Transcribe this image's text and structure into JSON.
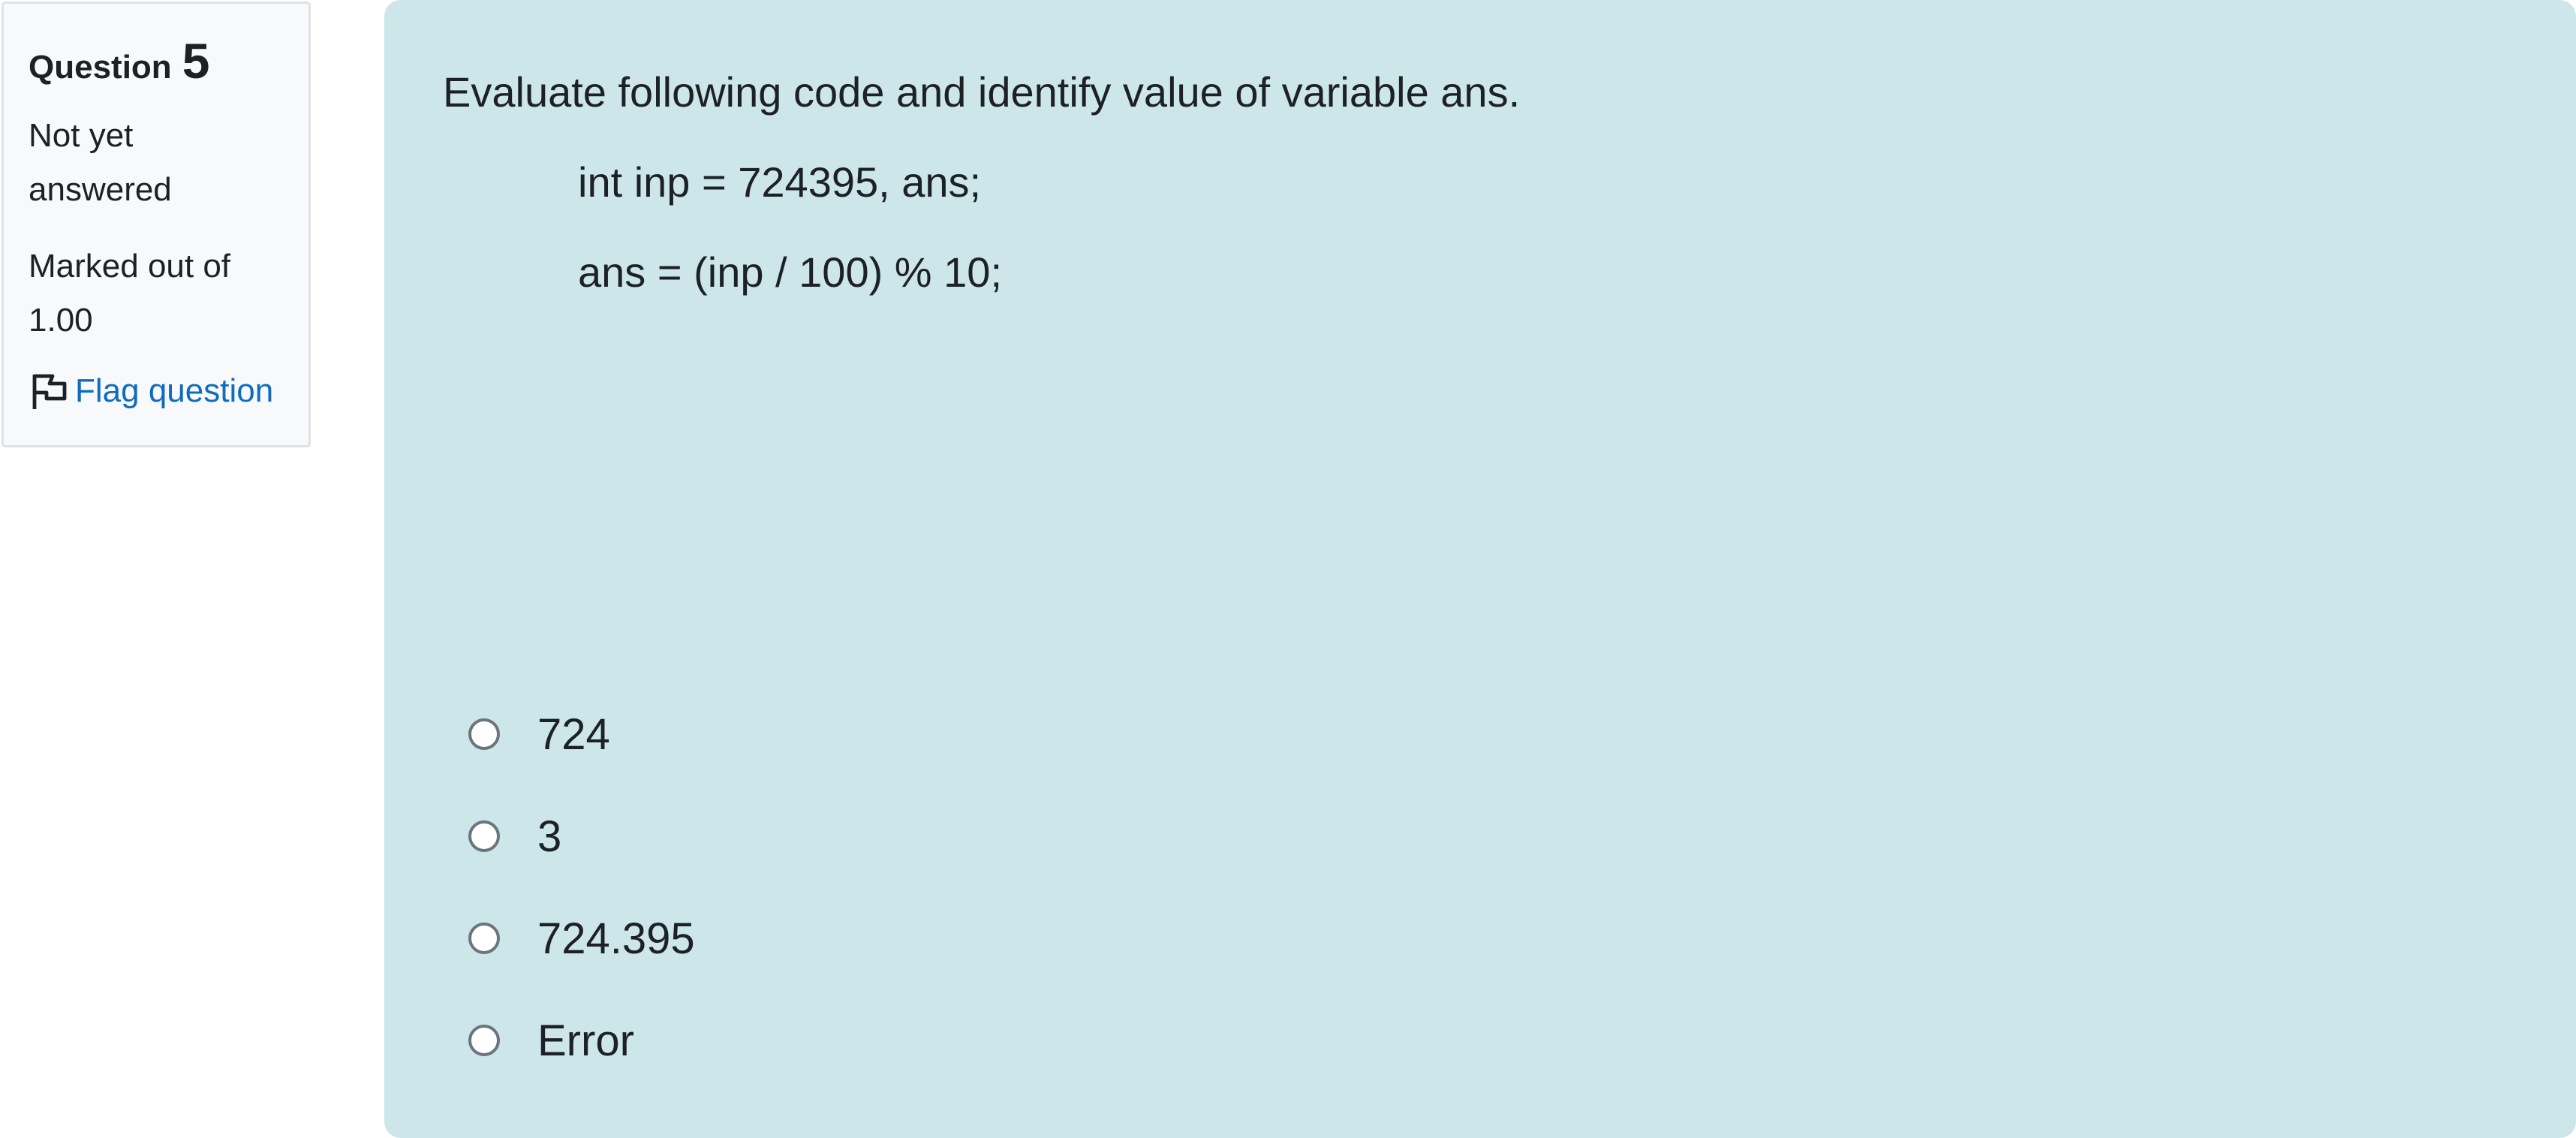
{
  "info": {
    "question_word": "Question",
    "question_number": "5",
    "state": "Not yet answered",
    "grade": "Marked out of 1.00",
    "flag_label": "Flag question"
  },
  "question": {
    "text": "Evaluate following code and identify value of variable ans.",
    "code_lines": [
      "int inp = 724395, ans;",
      "ans = (inp / 100) % 10;"
    ]
  },
  "options": [
    {
      "label": "724",
      "selected": false
    },
    {
      "label": "3",
      "selected": false
    },
    {
      "label": "724.395",
      "selected": false
    },
    {
      "label": "Error",
      "selected": false
    }
  ],
  "colors": {
    "content_background": "#cce6ea",
    "info_background": "#f8f9fa",
    "link": "#0f6cbf"
  },
  "icons": {
    "flag": "flag-outline-icon",
    "option": "radio-button"
  }
}
